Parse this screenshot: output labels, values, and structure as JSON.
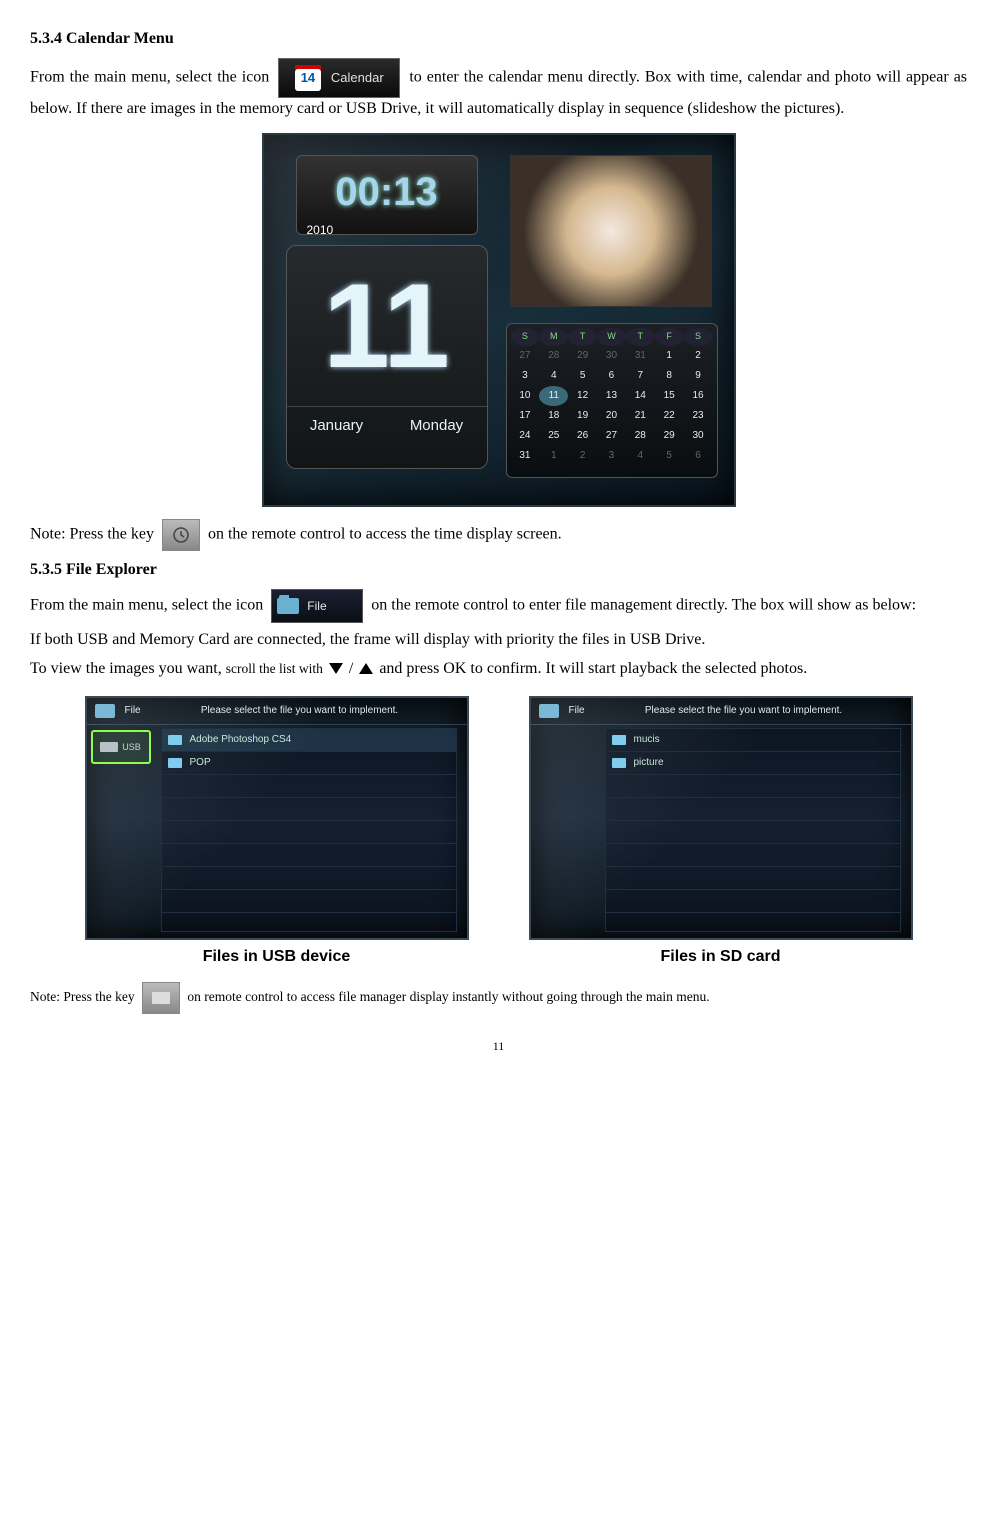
{
  "section1": {
    "heading": "5.3.4 Calendar Menu",
    "para1a": "From the main menu, select the icon",
    "calendar_icon_label": "Calendar",
    "calendar_icon_day": "14",
    "para1b": "to enter the calendar menu directly. Box with time, calendar and photo will appear as below. If there are images in the memory card or USB Drive, it will automatically display in sequence (slideshow the pictures)."
  },
  "calshot": {
    "time": "00:13",
    "year": "2010",
    "big_day": "11",
    "month_label": "January",
    "weekday_label": "Monday",
    "dow": [
      "S",
      "M",
      "T",
      "W",
      "T",
      "F",
      "S"
    ],
    "weeks": [
      [
        {
          "v": "27",
          "d": 1
        },
        {
          "v": "28",
          "d": 1
        },
        {
          "v": "29",
          "d": 1
        },
        {
          "v": "30",
          "d": 1
        },
        {
          "v": "31",
          "d": 1
        },
        {
          "v": "1"
        },
        {
          "v": "2"
        }
      ],
      [
        {
          "v": "3"
        },
        {
          "v": "4"
        },
        {
          "v": "5"
        },
        {
          "v": "6"
        },
        {
          "v": "7"
        },
        {
          "v": "8"
        },
        {
          "v": "9"
        }
      ],
      [
        {
          "v": "10"
        },
        {
          "v": "11",
          "t": 1
        },
        {
          "v": "12"
        },
        {
          "v": "13"
        },
        {
          "v": "14"
        },
        {
          "v": "15"
        },
        {
          "v": "16"
        }
      ],
      [
        {
          "v": "17"
        },
        {
          "v": "18"
        },
        {
          "v": "19"
        },
        {
          "v": "20"
        },
        {
          "v": "21"
        },
        {
          "v": "22"
        },
        {
          "v": "23"
        }
      ],
      [
        {
          "v": "24"
        },
        {
          "v": "25"
        },
        {
          "v": "26"
        },
        {
          "v": "27"
        },
        {
          "v": "28"
        },
        {
          "v": "29"
        },
        {
          "v": "30"
        }
      ],
      [
        {
          "v": "31"
        },
        {
          "v": "1",
          "d": 1
        },
        {
          "v": "2",
          "d": 1
        },
        {
          "v": "3",
          "d": 1
        },
        {
          "v": "4",
          "d": 1
        },
        {
          "v": "5",
          "d": 1
        },
        {
          "v": "6",
          "d": 1
        }
      ]
    ]
  },
  "note1a": "Note: Press the key",
  "time_key_label": "Time",
  "note1b": "on the remote control to access the time display screen.",
  "section2": {
    "heading": "5.3.5   File Explorer",
    "para1a": "From the main menu, select the icon",
    "file_icon_label": "File",
    "para1b": "on the remote control to enter file management directly. The box will show as below:",
    "para2": "If both USB and Memory Card are connected, the frame will display with priority the files in USB Drive.",
    "para3a": "To view the images you want,",
    "para3b": "scroll the list with",
    "slash": "/",
    "para3c": "and press OK to confirm. It will start playback the selected photos."
  },
  "explorers": {
    "header_text": "Please select the file you want to implement.",
    "header_label": "File",
    "usb": {
      "sidebar": [
        "USB"
      ],
      "items": [
        "Adobe Photoshop CS4",
        "POP"
      ],
      "caption": "Files in USB device"
    },
    "sd": {
      "items": [
        "mucis",
        "picture"
      ],
      "caption": "Files in SD card"
    }
  },
  "note2a": "Note: Press the key",
  "note2b": "on remote control to access file manager display instantly without going through the main menu.",
  "page_num": "11"
}
